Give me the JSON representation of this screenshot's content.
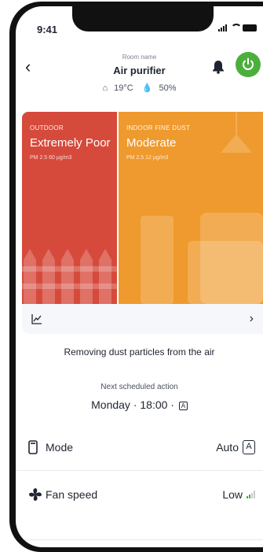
{
  "status_bar": {
    "time": "9:41"
  },
  "header": {
    "room_caption": "Room name",
    "title": "Air purifier",
    "temperature": "19°C",
    "humidity": "50%"
  },
  "cards": {
    "outdoor": {
      "label": "OUTDOOR",
      "value": "Extremely Poor",
      "pm": "PM 2.5 60 μg/m3",
      "color": "#d64a3c"
    },
    "indoor": {
      "label": "INDOOR FINE DUST",
      "value": "Moderate",
      "pm": "PM 2.5 12 μg/m3",
      "color": "#ef9a2e"
    }
  },
  "status_message": "Removing dust particles from the air",
  "schedule": {
    "label": "Next scheduled action",
    "value": "Monday · 18:00 ·",
    "badge": "A"
  },
  "settings": {
    "mode": {
      "label": "Mode",
      "value": "Auto",
      "badge": "A"
    },
    "fan_speed": {
      "label": "Fan speed",
      "value": "Low",
      "level": 0.33
    }
  },
  "colors": {
    "power_on": "#4caf3c",
    "accent_green": "#4caf3c"
  }
}
